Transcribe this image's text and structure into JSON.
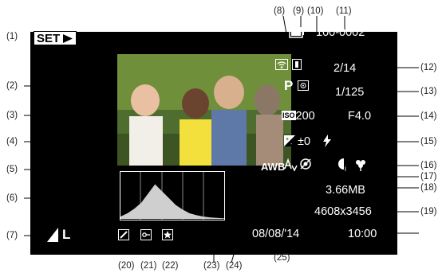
{
  "set_label": "SET",
  "callouts": {
    "c1": "(1)",
    "c2": "(2)",
    "c3": "(3)",
    "c4": "(4)",
    "c5": "(5)",
    "c6": "(6)",
    "c7": "(7)",
    "c8": "(8)",
    "c9": "(9)",
    "c10": "(10)",
    "c11": "(11)",
    "c12": "(12)",
    "c13": "(13)",
    "c14": "(14)",
    "c15": "(15)",
    "c16": "(16)",
    "c17": "(17)",
    "c18": "(18)",
    "c19": "(19)",
    "c20": "(20)",
    "c21": "(21)",
    "c22": "(22)",
    "c23": "(23)",
    "c24": "(24)",
    "c25": "(25)"
  },
  "display": {
    "folder_file": "100-0002",
    "image_count": "2/14",
    "mode": "P",
    "shutter": "1/125",
    "iso_label": "ISO",
    "iso_value": "200",
    "aperture": "F4.0",
    "exposure_comp": "±0",
    "white_balance": "AWB",
    "file_size": "3.66MB",
    "resolution": "4608x3456",
    "image_size": "L",
    "date": "08/08/'14",
    "time": "10:00"
  },
  "icons": {
    "set_arrow": "play-triangle-icon",
    "battery": "battery-icon",
    "wifi": "wifi-icon",
    "protect": "protect-icon",
    "metering": "metering-icon",
    "exposure": "exposure-compensation-icon",
    "flash": "flash-icon",
    "i_contrast": "i-contrast-icon",
    "macro": "macro-icon",
    "my_colors": "my-colors-icon",
    "red_eye": "red-eye-icon",
    "edited": "edited-icon",
    "protect_key": "key-icon",
    "favorite": "star-icon",
    "compression": "compression-icon"
  },
  "histogram": {
    "values": [
      0.05,
      0.12,
      0.22,
      0.35,
      0.55,
      0.75,
      0.6,
      0.45,
      0.3,
      0.2,
      0.12,
      0.08,
      0.05,
      0.03,
      0.02,
      0.01
    ]
  },
  "colors": {
    "screen": "#000000",
    "text": "#ffffff",
    "accent": "#ffffff"
  }
}
